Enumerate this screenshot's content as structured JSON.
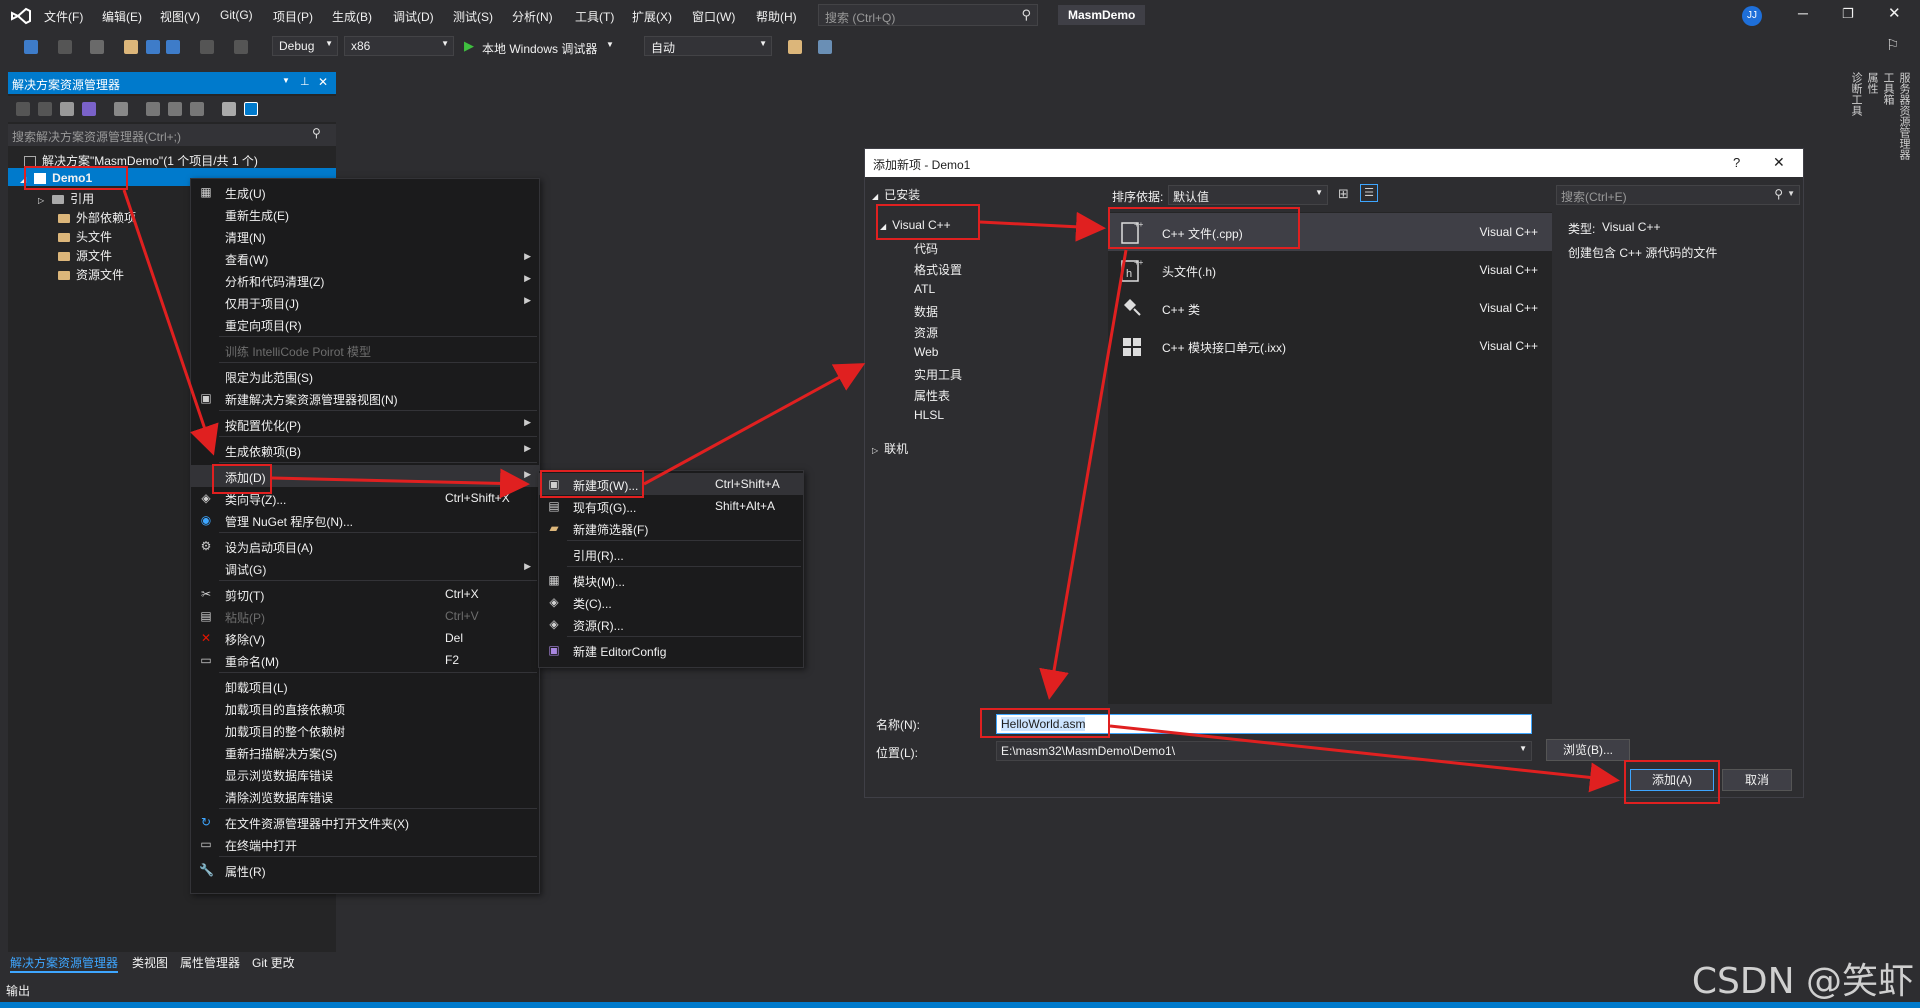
{
  "menubar": {
    "items": [
      "文件(F)",
      "编辑(E)",
      "视图(V)",
      "Git(G)",
      "项目(P)",
      "生成(B)",
      "调试(D)",
      "测试(S)",
      "分析(N)",
      "工具(T)",
      "扩展(X)",
      "窗口(W)",
      "帮助(H)"
    ],
    "search_placeholder": "搜索 (Ctrl+Q)",
    "solution_title": "MasmDemo",
    "avatar": "JJ"
  },
  "toolbar": {
    "config": "Debug",
    "platform": "x86",
    "run_label": "本地 Windows 调试器",
    "mode": "自动"
  },
  "right_rail": [
    "服务器资源管理器",
    "工具箱",
    "属性",
    "诊断工具"
  ],
  "solution_explorer": {
    "title": "解决方案资源管理器",
    "search_placeholder": "搜索解决方案资源管理器(Ctrl+;)",
    "solution_node": "解决方案\"MasmDemo\"(1 个项目/共 1 个)",
    "project_node": "Demo1",
    "children": [
      "引用",
      "外部依赖项",
      "头文件",
      "源文件",
      "资源文件"
    ],
    "bottom_tabs": [
      "解决方案资源管理器",
      "类视图",
      "属性管理器",
      "Git 更改"
    ],
    "output_label": "输出"
  },
  "context_menu": {
    "items": [
      {
        "label": "生成(U)",
        "shortcut": "",
        "arrow": false,
        "icon": "build-icon"
      },
      {
        "label": "重新生成(E)",
        "shortcut": "",
        "arrow": false,
        "icon": ""
      },
      {
        "label": "清理(N)",
        "shortcut": "",
        "arrow": false,
        "icon": ""
      },
      {
        "label": "查看(W)",
        "shortcut": "",
        "arrow": true,
        "icon": ""
      },
      {
        "label": "分析和代码清理(Z)",
        "shortcut": "",
        "arrow": true,
        "icon": ""
      },
      {
        "label": "仅用于项目(J)",
        "shortcut": "",
        "arrow": true,
        "icon": ""
      },
      {
        "label": "重定向项目(R)",
        "shortcut": "",
        "arrow": false,
        "icon": ""
      },
      {
        "label": "训练 IntelliCode Poirot 模型",
        "shortcut": "",
        "arrow": false,
        "icon": "",
        "disabled": true
      },
      {
        "label": "限定为此范围(S)",
        "shortcut": "",
        "arrow": false,
        "icon": ""
      },
      {
        "label": "新建解决方案资源管理器视图(N)",
        "shortcut": "",
        "arrow": false,
        "icon": "new-view-icon"
      },
      {
        "label": "按配置优化(P)",
        "shortcut": "",
        "arrow": true,
        "icon": ""
      },
      {
        "label": "生成依赖项(B)",
        "shortcut": "",
        "arrow": true,
        "icon": ""
      },
      {
        "label": "添加(D)",
        "shortcut": "",
        "arrow": true,
        "icon": ""
      },
      {
        "label": "类向导(Z)...",
        "shortcut": "Ctrl+Shift+X",
        "arrow": false,
        "icon": "class-wizard-icon"
      },
      {
        "label": "管理 NuGet 程序包(N)...",
        "shortcut": "",
        "arrow": false,
        "icon": "nuget-icon"
      },
      {
        "label": "设为启动项目(A)",
        "shortcut": "",
        "arrow": false,
        "icon": "gear-icon"
      },
      {
        "label": "调试(G)",
        "shortcut": "",
        "arrow": true,
        "icon": ""
      },
      {
        "label": "剪切(T)",
        "shortcut": "Ctrl+X",
        "arrow": false,
        "icon": "cut-icon"
      },
      {
        "label": "粘贴(P)",
        "shortcut": "Ctrl+V",
        "arrow": false,
        "icon": "paste-icon",
        "disabled": true
      },
      {
        "label": "移除(V)",
        "shortcut": "Del",
        "arrow": false,
        "icon": "remove-icon"
      },
      {
        "label": "重命名(M)",
        "shortcut": "F2",
        "arrow": false,
        "icon": "rename-icon"
      },
      {
        "label": "卸载项目(L)",
        "shortcut": "",
        "arrow": false,
        "icon": ""
      },
      {
        "label": "加载项目的直接依赖项",
        "shortcut": "",
        "arrow": false,
        "icon": ""
      },
      {
        "label": "加载项目的整个依赖树",
        "shortcut": "",
        "arrow": false,
        "icon": ""
      },
      {
        "label": "重新扫描解决方案(S)",
        "shortcut": "",
        "arrow": false,
        "icon": ""
      },
      {
        "label": "显示浏览数据库错误",
        "shortcut": "",
        "arrow": false,
        "icon": ""
      },
      {
        "label": "清除浏览数据库错误",
        "shortcut": "",
        "arrow": false,
        "icon": ""
      },
      {
        "label": "在文件资源管理器中打开文件夹(X)",
        "shortcut": "",
        "arrow": false,
        "icon": "open-folder-icon"
      },
      {
        "label": "在终端中打开",
        "shortcut": "",
        "arrow": false,
        "icon": "terminal-icon"
      },
      {
        "label": "属性(R)",
        "shortcut": "",
        "arrow": false,
        "icon": "wrench-icon"
      }
    ]
  },
  "submenu": {
    "items": [
      {
        "label": "新建项(W)...",
        "shortcut": "Ctrl+Shift+A"
      },
      {
        "label": "现有项(G)...",
        "shortcut": "Shift+Alt+A"
      },
      {
        "label": "新建筛选器(F)",
        "shortcut": ""
      },
      {
        "label": "引用(R)...",
        "shortcut": ""
      },
      {
        "label": "模块(M)...",
        "shortcut": ""
      },
      {
        "label": "类(C)...",
        "shortcut": ""
      },
      {
        "label": "资源(R)...",
        "shortcut": ""
      },
      {
        "label": "新建 EditorConfig",
        "shortcut": ""
      }
    ]
  },
  "dialog": {
    "title": "添加新项 - Demo1",
    "help": "?",
    "installed": "已安装",
    "category_root": "Visual C++",
    "categories": [
      "代码",
      "格式设置",
      "ATL",
      "数据",
      "资源",
      "Web",
      "实用工具",
      "属性表",
      "HLSL"
    ],
    "online": "联机",
    "sort_label": "排序依据:",
    "sort_value": "默认值",
    "search_placeholder": "搜索(Ctrl+E)",
    "templates": [
      {
        "name": "C++ 文件(.cpp)",
        "lang": "Visual C++"
      },
      {
        "name": "头文件(.h)",
        "lang": "Visual C++"
      },
      {
        "name": "C++ 类",
        "lang": "Visual C++"
      },
      {
        "name": "C++ 模块接口单元(.ixx)",
        "lang": "Visual C++"
      }
    ],
    "type_label": "类型:",
    "type_value": "Visual C++",
    "description": "创建包含 C++ 源代码的文件",
    "name_label": "名称(N):",
    "name_value": "HelloWorld.asm",
    "location_label": "位置(L):",
    "location_value": "E:\\masm32\\MasmDemo\\Demo1\\",
    "browse": "浏览(B)...",
    "add": "添加(A)",
    "cancel": "取消"
  },
  "watermark": "CSDN @笑虾",
  "colors": {
    "accent": "#007acc",
    "annotation": "#e02020",
    "background": "#2d2d30"
  }
}
